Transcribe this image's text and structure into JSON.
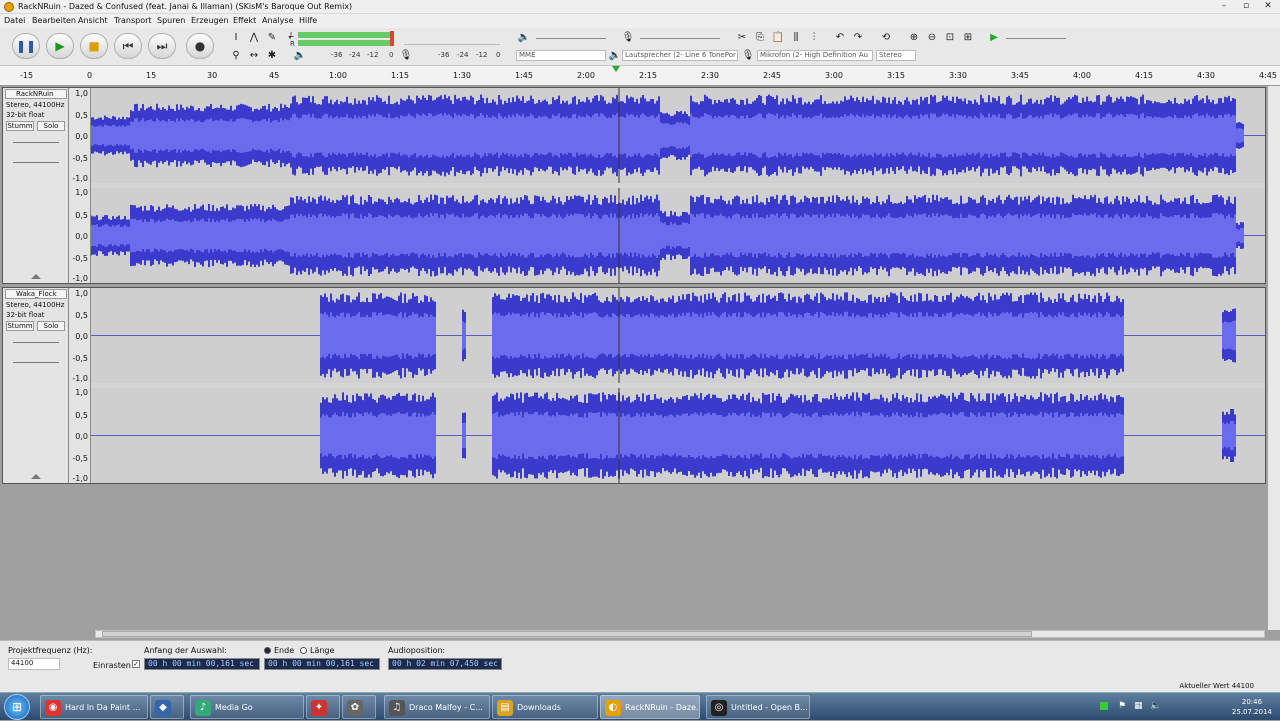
{
  "window": {
    "title": "RackNRuin - Dazed & Confused (feat. Janai & Illaman) (SKisM's Baroque Out Remix)"
  },
  "menu": [
    "Datei",
    "Bearbeiten",
    "Ansicht",
    "Transport",
    "Spuren",
    "Erzeugen",
    "Effekt",
    "Analyse",
    "Hilfe"
  ],
  "meter": {
    "labels": [
      "-36",
      "-24",
      "-12",
      "0",
      "-36",
      "-24",
      "-12",
      "0"
    ],
    "ch_l": "L",
    "ch_r": "R"
  },
  "devices": {
    "host": "MME",
    "output": "Lautsprecher (2- Line 6 TonePor",
    "input": "Mikrofon (2- High Definition Au",
    "channels": "Stereo"
  },
  "ruler": [
    "-15",
    "0",
    "15",
    "30",
    "45",
    "1:00",
    "1:15",
    "1:30",
    "1:45",
    "2:00",
    "2:15",
    "2:30",
    "2:45",
    "3:00",
    "3:15",
    "3:30",
    "3:45",
    "4:00",
    "4:15",
    "4:30",
    "4:45"
  ],
  "tracks": [
    {
      "name": "RackNRuin",
      "info1": "Stereo, 44100Hz",
      "info2": "32-bit float",
      "mute": "Stumm",
      "solo": "Solo"
    },
    {
      "name": "Waka_Flock",
      "info1": "Stereo, 44100Hz",
      "info2": "32-bit float",
      "mute": "Stumm",
      "solo": "Solo"
    }
  ],
  "scale": [
    "1,0",
    "0,5",
    "0,0",
    "-0,5",
    "-1,0"
  ],
  "selection": {
    "rate_label": "Projektfrequenz (Hz):",
    "rate_value": "44100",
    "start_label": "Anfang der Auswahl:",
    "end_label": "Ende",
    "length_label": "Länge",
    "snap_label": "Einrasten",
    "audiopos_label": "Audioposition:",
    "start_value": "00 h 00 min 00,161 sec",
    "end_value": "00 h 00 min 00,161 sec",
    "audiopos_value": "00 h 02 min 07,450 sec"
  },
  "status": {
    "right": "Aktueller Wert 44100"
  },
  "taskbar": {
    "items": [
      "Hard In Da Paint ...",
      "",
      "Media Go",
      "",
      "",
      "Draco Malfoy - C...",
      "Downloads",
      "RackNRuin - Daze...",
      "Untitled - Open B..."
    ],
    "time": "20:46",
    "date": "25.07.2014"
  },
  "colors": {
    "wave": "#3a3acc",
    "wave_rms": "#6b6bee",
    "track_bg": "#d6d6d6",
    "cursor": "#000000"
  }
}
